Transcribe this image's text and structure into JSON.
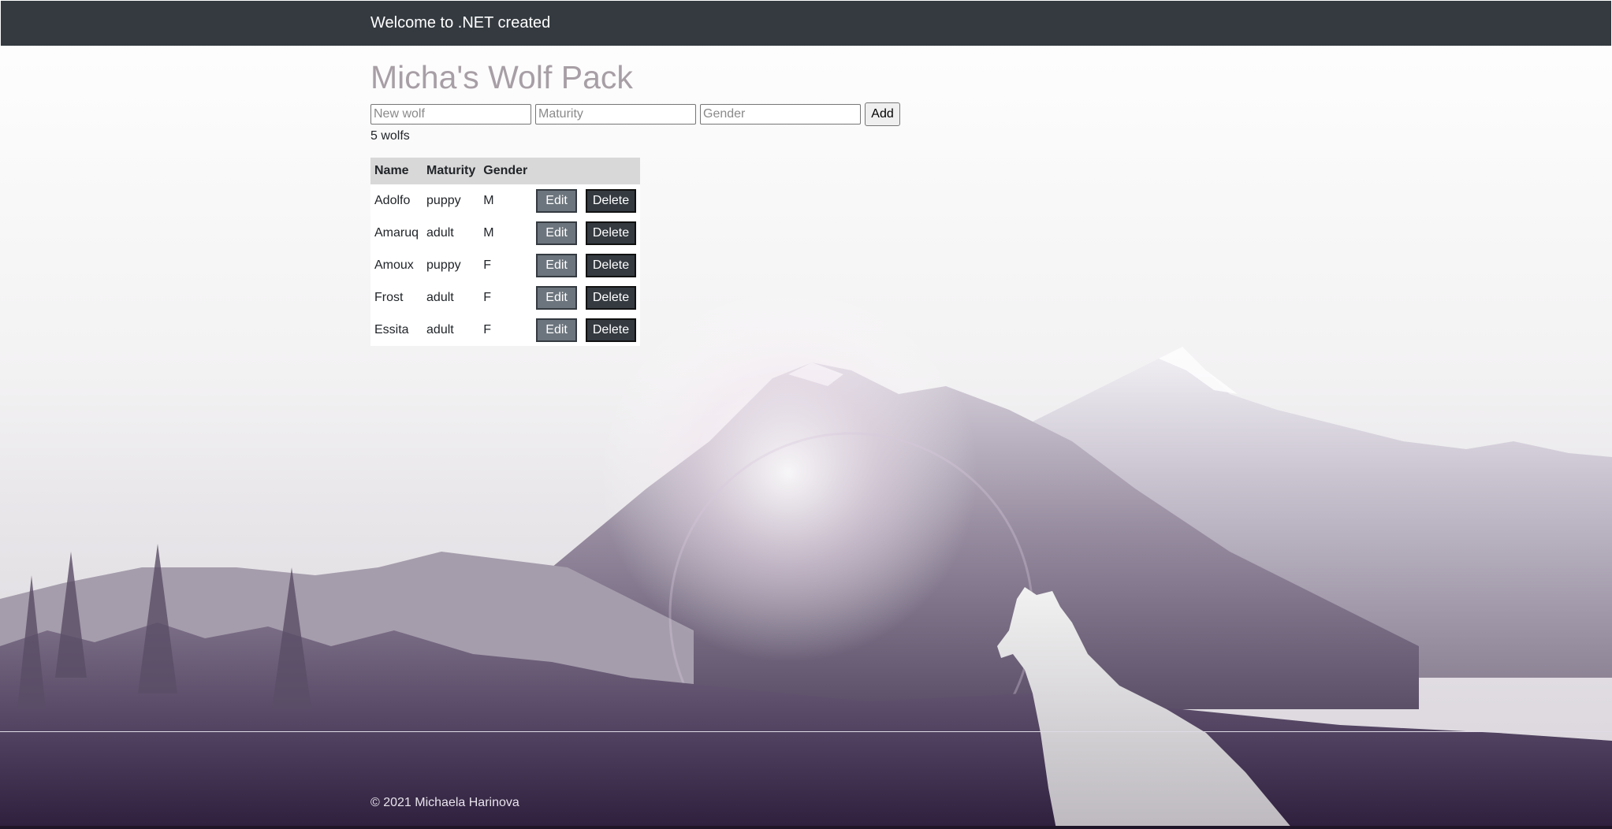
{
  "navbar": {
    "brand": "Welcome to .NET created"
  },
  "page": {
    "title": "Micha's Wolf Pack"
  },
  "form": {
    "name_placeholder": "New wolf",
    "maturity_placeholder": "Maturity",
    "gender_placeholder": "Gender",
    "add_label": "Add"
  },
  "count_text": "5 wolfs",
  "table": {
    "headers": [
      "Name",
      "Maturity",
      "Gender"
    ],
    "rows": [
      {
        "name": "Adolfo",
        "maturity": "puppy",
        "gender": "M"
      },
      {
        "name": "Amaruq",
        "maturity": "adult",
        "gender": "M"
      },
      {
        "name": "Amoux",
        "maturity": "puppy",
        "gender": "F"
      },
      {
        "name": "Frost",
        "maturity": "adult",
        "gender": "F"
      },
      {
        "name": "Essita",
        "maturity": "adult",
        "gender": "F"
      }
    ],
    "edit_label": "Edit",
    "delete_label": "Delete"
  },
  "footer": {
    "text": "© 2021 Michaela Harinova"
  },
  "colors": {
    "navbar": "#343a40",
    "title": "#a79fa5",
    "edit_button": "#6c757d",
    "delete_button": "#343a40"
  }
}
